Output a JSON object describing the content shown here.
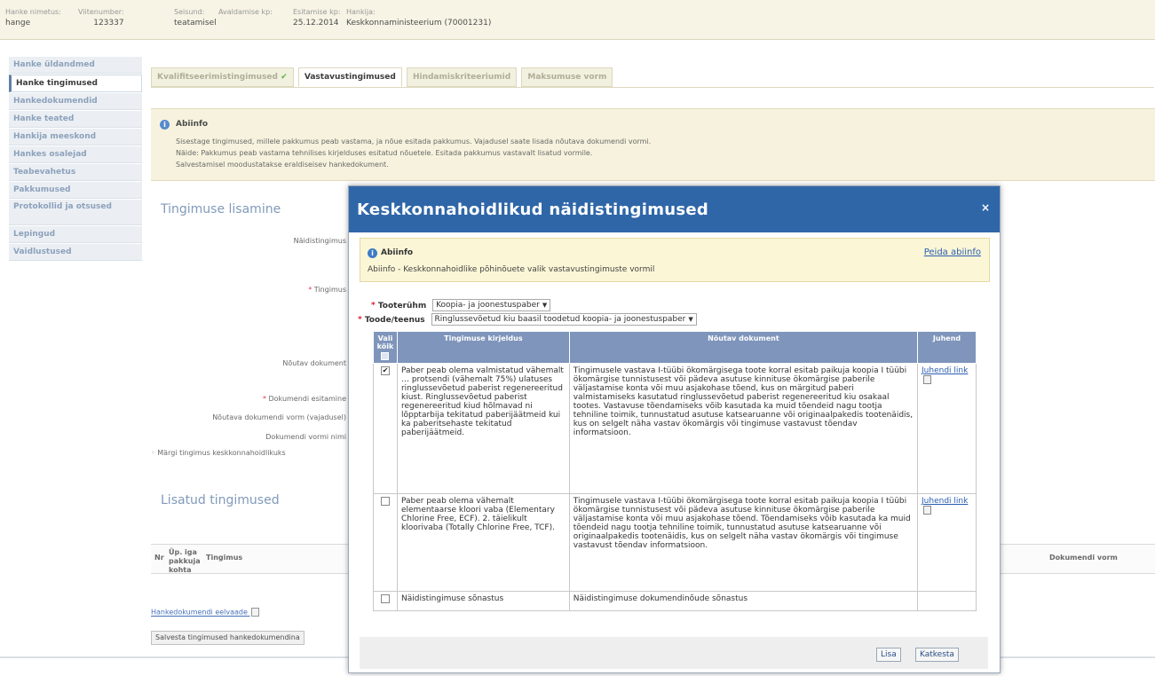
{
  "topbar": {
    "fields": [
      {
        "label": "Hanke nimetus:",
        "value": "hange"
      },
      {
        "label": "Viitenumber:",
        "value": "123337"
      },
      {
        "label": "Seisund:",
        "value": "teatamisel"
      },
      {
        "label": "Avaldamise kp:",
        "value": ""
      },
      {
        "label": "Esitamise kp:",
        "value": "25.12.2014"
      },
      {
        "label": "Hankija:",
        "value": "Keskkonnaministeerium (70001231)"
      }
    ]
  },
  "sidebar": {
    "items": [
      {
        "label": "Hanke üldandmed"
      },
      {
        "label": "Hanke tingimused"
      },
      {
        "label": "Hankedokumendid"
      },
      {
        "label": "Hanke teated"
      },
      {
        "label": "Hankija meeskond"
      },
      {
        "label": "Hankes osalejad"
      },
      {
        "label": "Teabevahetus"
      },
      {
        "label": "Pakkumused"
      },
      {
        "label": "Protokollid ja otsused"
      },
      {
        "label": "Lepingud"
      },
      {
        "label": "Vaidlustused"
      }
    ]
  },
  "tabs": [
    {
      "label": "Kvalifitseerimistingimused"
    },
    {
      "label": "Vastavustingimused"
    },
    {
      "label": "Hindamiskriteeriumid"
    },
    {
      "label": "Maksumuse vorm"
    }
  ],
  "background": {
    "info_title": "Abiinfo",
    "info_lines": [
      "Sisestage tingimused, millele pakkumus peab vastama, ja nõue esitada pakkumus. Vajadusel saate lisada nõutava dokumendi vormi.",
      "Näide: Pakkumus peab vastama tehnilises kirjelduses esitatud nõuetele. Esitada pakkumus vastavalt lisatud vormile.",
      "Salvestamisel moodustatakse eraldiseisev hankedokument."
    ],
    "add_heading": "Tingimuse lisamine",
    "labels": {
      "example": "Näidistingimus",
      "condition": "Tingimus",
      "required_doc": "Nõutav dokument",
      "doc_submit": "Dokumendi esitamine",
      "doc_form": "Nõutava dokumendi vorm (vajadusel)",
      "doc_form_name": "Dokumendi vormi nimi",
      "mark_env": "Märgi tingimus keskkonnahoidlikuks"
    },
    "added_heading": "Lisatud tingimused",
    "grid_headers": {
      "nr": "Nr",
      "per_bidder": "Üp. iga pakkuja kohta",
      "condition": "Tingimus",
      "doc_form": "Dokumendi vorm"
    },
    "preview_link": "Hankedokumendi eelvaade",
    "save_button": "Salvesta tingimused hankedokumendina"
  },
  "modal": {
    "title": "Keskkonnahoidlikud näidistingimused",
    "close": "×",
    "info_title": "Abiinfo",
    "info_text": "Abiinfo - Keskkonnahoidlike põhinõuete valik vastavustingimuste vormil",
    "hide_link": "Peida abiinfo",
    "product_group_label": "Tooterühm",
    "product_group_value": "Koopia- ja joonestuspaber",
    "product_label": "Toode/teenus",
    "product_value": "Ringlussevõetud kiu baasil toodetud koopia- ja joonestuspaber",
    "table": {
      "headers": {
        "select_all": "Vali kõik",
        "description": "Tingimuse kirjeldus",
        "document": "Nõutav dokument",
        "guide": "Juhend"
      },
      "rows": [
        {
          "checked": "✔",
          "description": "Paber peab olema valmistatud vähemalt … protsendi (vähemalt 75%) ulatuses ringlussevõetud paberist regenereeritud kiust. Ringlussevõetud paberist regenereeritud kiud hõlmavad ni lõpptarbija tekitatud paberijäätmeid kui ka paberitsehaste tekitatud paberijäätmeid.",
          "document": "Tingimusele vastava I-tüübi ökomärgisega toote korral esitab paikuja koopia I tüübi ökomärgise tunnistusest või pädeva asutuse kinnituse ökomärgise paberile väljastamise konta või muu asjakohase tõend, kus on märgitud paberi valmistamiseks kasutatud ringlussevõetud paberist regenereeritud kiu osakaal tootes. Vastavuse tõendamiseks võib kasutada ka muid tõendeid nagu tootja tehniline toimik, tunnustatud asutuse katsearuanne või originaalpakedis tootenäidis, kus on selgelt näha vastav ökomärgis või tingimuse vastavust tõendav informatsioon.",
          "guide": "Juhendi link"
        },
        {
          "checked": "",
          "description": "Paber peab olema vähemalt elementaarse kloori vaba (Elementary Chlorine Free, ECF). 2. täielikult kloorivaba (Totally Chlorine Free, TCF).",
          "document": "Tingimusele vastava I-tüübi ökomärgisega toote korral esitab paikuja koopia I tüübi ökomärgise tunnistusest või pädeva asutuse kinnituse ökomärgise paberile väljastamise konta või muu asjakohase tõend. Tõendamiseks võib kasutada ka muid tõendeid nagu tootja tehniline toimik, tunnustatud asutuse katsearuanne või originaalpakedis tootenäidis, kus on selgelt näha vastav ökomärgis või tingimuse vastavust tõendav informatsioon.",
          "guide": "Juhendi link"
        },
        {
          "checked": "",
          "description": "Näidistingimuse sõnastus",
          "document": "Näidistingimuse dokumendinõude sõnastus",
          "guide": ""
        }
      ]
    },
    "add_button": "Lisa",
    "cancel_button": "Katkesta"
  },
  "colors": {
    "modal_header": "#2f66a8",
    "table_header": "#7f95bb",
    "info_bg": "#fbf6d6",
    "link": "#2a5db0"
  }
}
